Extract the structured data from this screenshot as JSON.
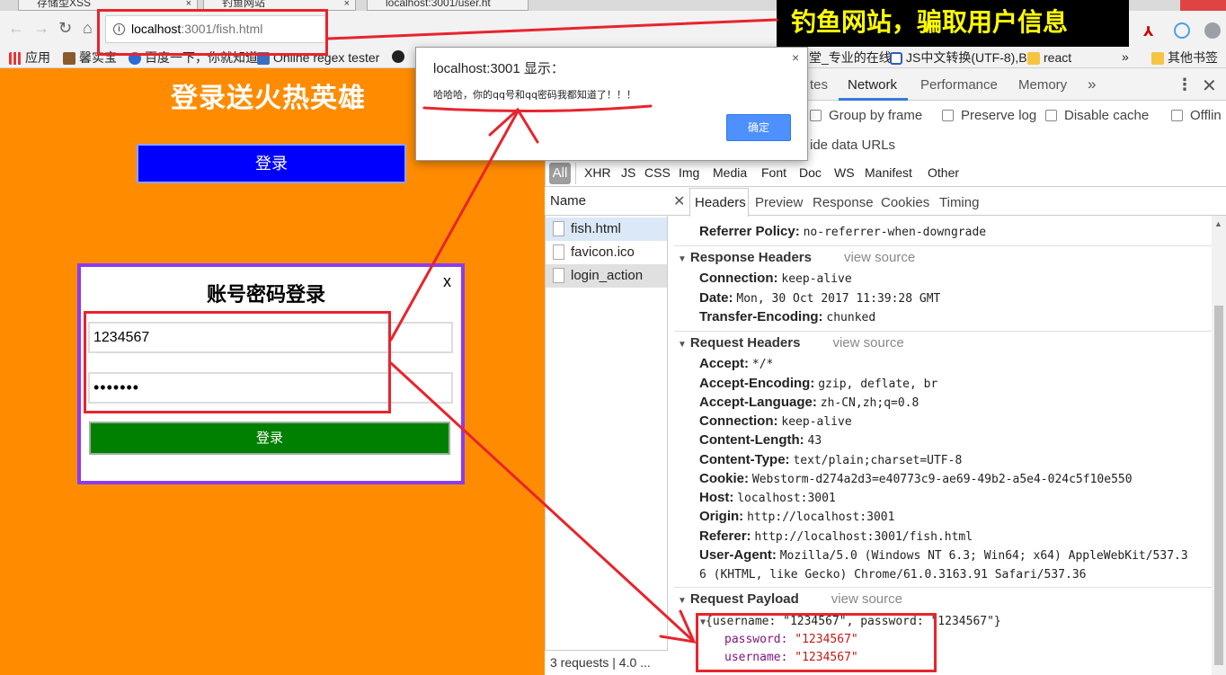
{
  "browser": {
    "tabs": [
      {
        "label": "存储型XSS"
      },
      {
        "label": "钓鱼网站"
      },
      {
        "label": "localhost:3001/user.ht"
      }
    ],
    "url_host": "localhost",
    "url_path": ":3001/fish.html",
    "bookmarks": [
      {
        "label": "应用"
      },
      {
        "label": "馨实宝"
      },
      {
        "label": "百度一下，你就知道"
      },
      {
        "label": "Online regex tester"
      },
      {
        "label": "堂_专业的在线"
      },
      {
        "label": "JS中文转换(UTF-8),B"
      },
      {
        "label": "react"
      },
      {
        "label": "»"
      },
      {
        "label": "其他书签"
      }
    ]
  },
  "page": {
    "title": "登录送火热英雄",
    "promo_button": "登录",
    "modal": {
      "title": "账号密码登录",
      "close": "x",
      "username_value": "1234567",
      "password_value": "•••••••",
      "submit": "登录"
    }
  },
  "alert": {
    "title": "localhost:3001 显示：",
    "message": "哈哈哈，你的qq号和qq密码我都知道了！！！",
    "ok": "确定",
    "close": "×"
  },
  "banner": {
    "text": "钓鱼网站，骗取用户信息"
  },
  "devtools": {
    "tabs": [
      "tes",
      "Network",
      "Performance",
      "Memory",
      "»"
    ],
    "options": [
      "Group by frame",
      "Preserve log",
      "Disable cache",
      "Offlin"
    ],
    "hide_data_urls": "ide data URLs",
    "filters": [
      "All",
      "XHR",
      "JS",
      "CSS",
      "Img",
      "Media",
      "Font",
      "Doc",
      "WS",
      "Manifest",
      "Other"
    ],
    "name_header": "Name",
    "requests": [
      "fish.html",
      "favicon.ico",
      "login_action"
    ],
    "status": "3 requests | 4.0 ...",
    "detail_tabs": [
      "Headers",
      "Preview",
      "Response",
      "Cookies",
      "Timing"
    ],
    "referrer_policy": {
      "key": "Referrer Policy:",
      "value": "no-referrer-when-downgrade"
    },
    "response_headers": {
      "title": "Response Headers",
      "view_source": "view source",
      "items": [
        {
          "key": "Connection:",
          "value": "keep-alive"
        },
        {
          "key": "Date:",
          "value": "Mon, 30 Oct 2017 11:39:28 GMT"
        },
        {
          "key": "Transfer-Encoding:",
          "value": "chunked"
        }
      ]
    },
    "request_headers": {
      "title": "Request Headers",
      "view_source": "view source",
      "items": [
        {
          "key": "Accept:",
          "value": "*/*"
        },
        {
          "key": "Accept-Encoding:",
          "value": "gzip, deflate, br"
        },
        {
          "key": "Accept-Language:",
          "value": "zh-CN,zh;q=0.8"
        },
        {
          "key": "Connection:",
          "value": "keep-alive"
        },
        {
          "key": "Content-Length:",
          "value": "43"
        },
        {
          "key": "Content-Type:",
          "value": "text/plain;charset=UTF-8"
        },
        {
          "key": "Cookie:",
          "value": "Webstorm-d274a2d3=e40773c9-ae69-49b2-a5e4-024c5f10e550"
        },
        {
          "key": "Host:",
          "value": "localhost:3001"
        },
        {
          "key": "Origin:",
          "value": "http://localhost:3001"
        },
        {
          "key": "Referer:",
          "value": "http://localhost:3001/fish.html"
        },
        {
          "key": "User-Agent:",
          "value": "Mozilla/5.0 (Windows NT 6.3; Win64; x64) AppleWebKit/537.3"
        },
        {
          "key": "",
          "value": "6 (KHTML, like Gecko) Chrome/61.0.3163.91 Safari/537.36"
        }
      ]
    },
    "request_payload": {
      "title": "Request Payload",
      "view_source": "view source",
      "summary_open": "{username: \"1234567\", password: \"1234567\"}",
      "password_key": "password:",
      "password_value": "\"1234567\"",
      "username_key": "username:",
      "username_value": "\"1234567\""
    }
  },
  "colors": {
    "page_bg": "#ff8c00",
    "annotation_red": "#e8242c",
    "banner_text": "#ffff00",
    "modal_border": "#8b3cf0",
    "submit_green": "#008000",
    "promo_blue": "#0000ff"
  }
}
